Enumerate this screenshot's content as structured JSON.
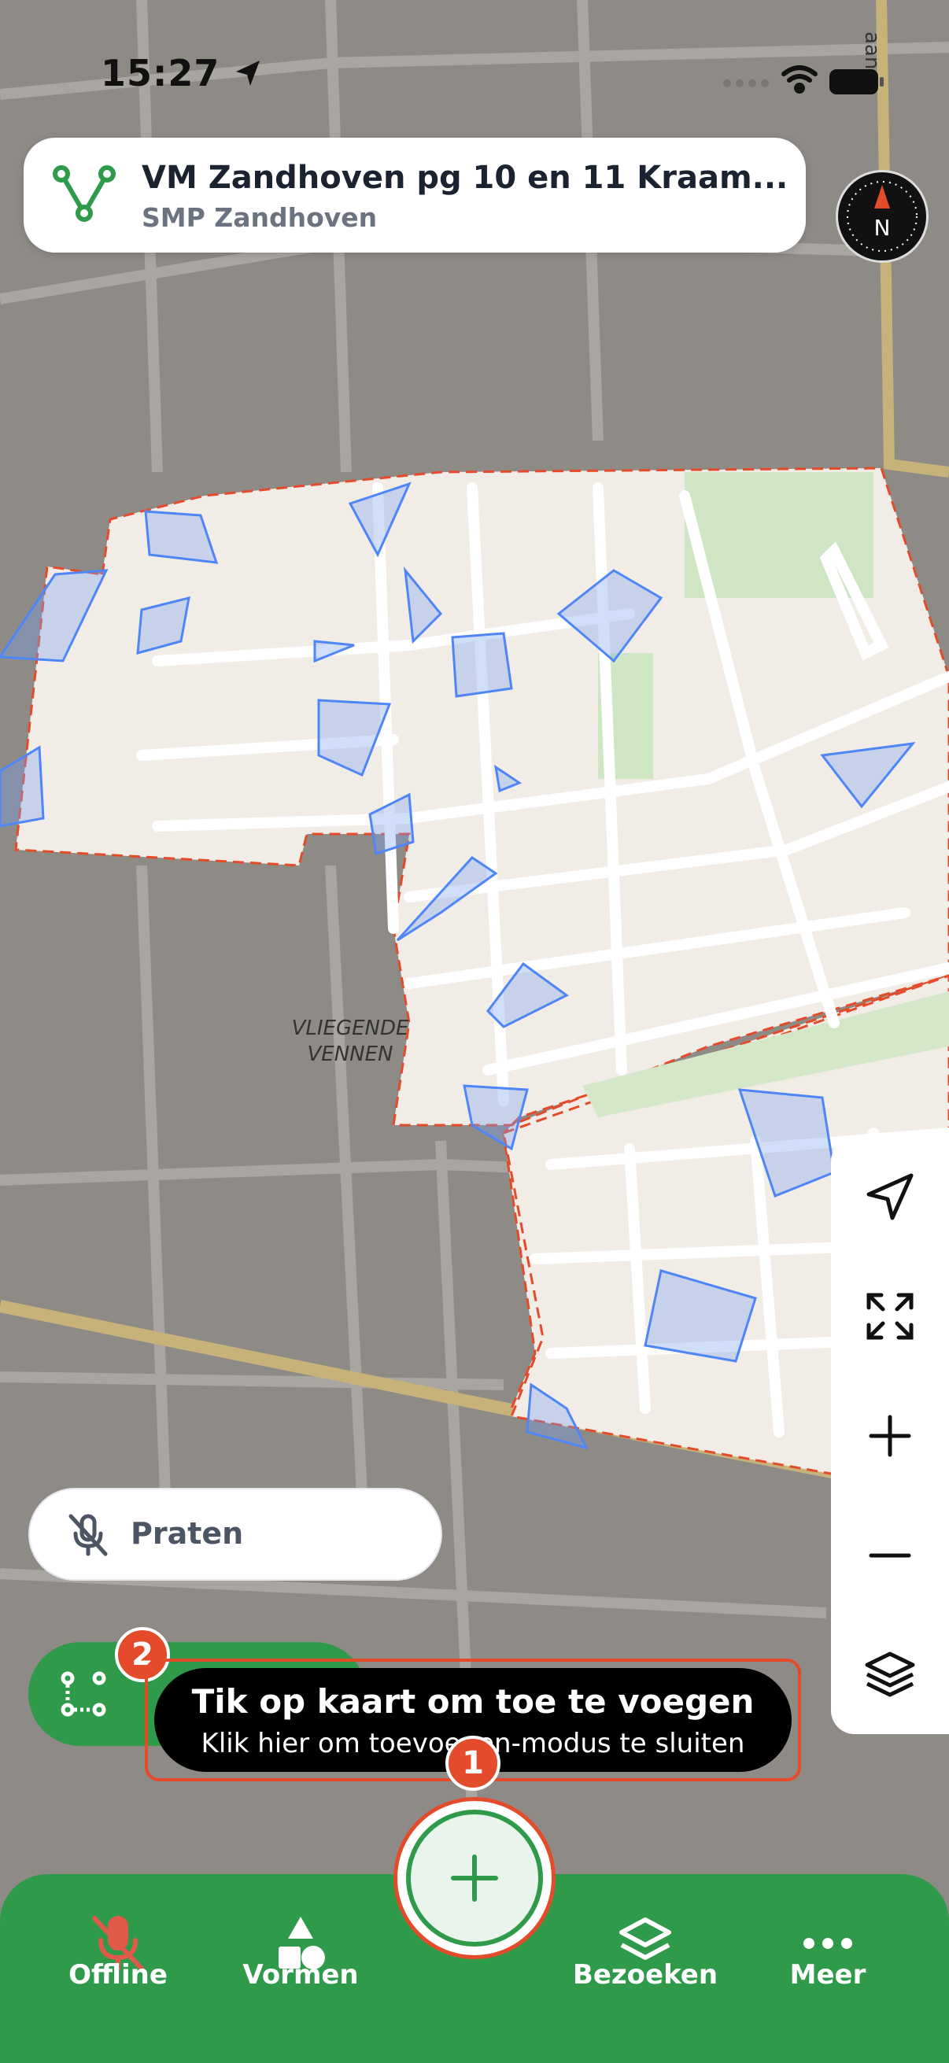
{
  "status_bar": {
    "time": "15:27"
  },
  "title_card": {
    "title": "VM Zandhoven pg 10 en 11 Kraam...",
    "subtitle": "SMP Zandhoven"
  },
  "map": {
    "place_label_line1": "VLIEGENDE",
    "place_label_line2": "VENNEN",
    "street_fragment": "aan"
  },
  "right_toolbar": {
    "items": [
      "locate-icon",
      "fit-bounds-icon",
      "zoom-in-icon",
      "zoom-out-icon",
      "layers-icon"
    ]
  },
  "talk": {
    "label": "Praten"
  },
  "badges": {
    "route": "2",
    "add": "1"
  },
  "toast": {
    "title": "Tik op kaart om toe te voegen",
    "subtitle": "Klik hier om toevoegen-modus te sluiten"
  },
  "bottom_nav": {
    "items": [
      {
        "label": "Offline",
        "icon": "mic-off-icon"
      },
      {
        "label": "Vormen",
        "icon": "shapes-icon"
      },
      {
        "label": "Bezoeken",
        "icon": "layers-icon"
      },
      {
        "label": "Meer",
        "icon": "more-icon"
      }
    ]
  },
  "colors": {
    "brand_green": "#2e9a4a",
    "alert_red": "#e34b2a",
    "polygon_blue": "#4f86f7"
  }
}
